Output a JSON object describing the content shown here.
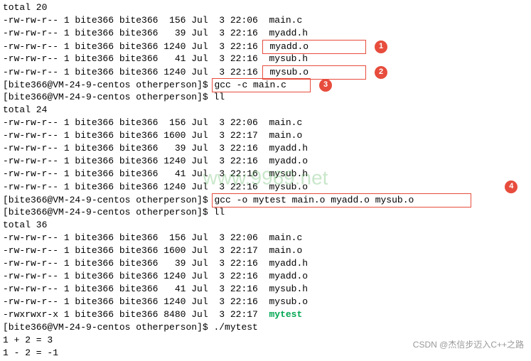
{
  "terminal": {
    "lines": [
      {
        "t": "text",
        "c": "total 20"
      },
      {
        "t": "text",
        "c": "-rw-rw-r-- 1 bite366 bite366  156 Jul  3 22:06  main.c"
      },
      {
        "t": "text",
        "c": "-rw-rw-r-- 1 bite366 bite366   39 Jul  3 22:16  myadd.h"
      },
      {
        "t": "file-box",
        "prefix": "-rw-rw-r-- 1 bite366 bite366 1240 Jul  3 22:16 ",
        "boxed": "myadd.o",
        "pad": "          ",
        "badge": "1"
      },
      {
        "t": "text",
        "c": "-rw-rw-r-- 1 bite366 bite366   41 Jul  3 22:16  mysub.h"
      },
      {
        "t": "file-box",
        "prefix": "-rw-rw-r-- 1 bite366 bite366 1240 Jul  3 22:16 ",
        "boxed": "mysub.o",
        "pad": "          ",
        "badge": "2"
      },
      {
        "t": "prompt-box",
        "prompt": "[bite366@VM-24-9-centos otherperson]$ ",
        "boxed": "gcc -c main.c",
        "pad": "    ",
        "badge": "3"
      },
      {
        "t": "prompt",
        "prompt": "[bite366@VM-24-9-centos otherperson]$ ",
        "cmd": "ll"
      },
      {
        "t": "text",
        "c": "total 24"
      },
      {
        "t": "text",
        "c": "-rw-rw-r-- 1 bite366 bite366  156 Jul  3 22:06  main.c"
      },
      {
        "t": "text",
        "c": "-rw-rw-r-- 1 bite366 bite366 1600 Jul  3 22:17  main.o"
      },
      {
        "t": "text",
        "c": "-rw-rw-r-- 1 bite366 bite366   39 Jul  3 22:16  myadd.h"
      },
      {
        "t": "text",
        "c": "-rw-rw-r-- 1 bite366 bite366 1240 Jul  3 22:16  myadd.o"
      },
      {
        "t": "text",
        "c": "-rw-rw-r-- 1 bite366 bite366   41 Jul  3 22:16  mysub.h"
      },
      {
        "t": "file-badge",
        "c": "-rw-rw-r-- 1 bite366 bite366 1240 Jul  3 22:16  mysub.o",
        "pad": "                                  ",
        "badge": "4"
      },
      {
        "t": "prompt-box",
        "prompt": "[bite366@VM-24-9-centos otherperson]$ ",
        "boxed": "gcc -o mytest main.o myadd.o mysub.o",
        "pad": "          "
      },
      {
        "t": "prompt",
        "prompt": "[bite366@VM-24-9-centos otherperson]$ ",
        "cmd": "ll"
      },
      {
        "t": "text",
        "c": "total 36"
      },
      {
        "t": "text",
        "c": "-rw-rw-r-- 1 bite366 bite366  156 Jul  3 22:06  main.c"
      },
      {
        "t": "text",
        "c": "-rw-rw-r-- 1 bite366 bite366 1600 Jul  3 22:17  main.o"
      },
      {
        "t": "text",
        "c": "-rw-rw-r-- 1 bite366 bite366   39 Jul  3 22:16  myadd.h"
      },
      {
        "t": "text",
        "c": "-rw-rw-r-- 1 bite366 bite366 1240 Jul  3 22:16  myadd.o"
      },
      {
        "t": "text",
        "c": "-rw-rw-r-- 1 bite366 bite366   41 Jul  3 22:16  mysub.h"
      },
      {
        "t": "text",
        "c": "-rw-rw-r-- 1 bite366 bite366 1240 Jul  3 22:16  mysub.o"
      },
      {
        "t": "exec-line",
        "prefix": "-rwxrwxr-x 1 bite366 bite366 8480 Jul  3 22:17  ",
        "exec": "mytest"
      },
      {
        "t": "prompt",
        "prompt": "[bite366@VM-24-9-centos otherperson]$ ",
        "cmd": "./mytest"
      },
      {
        "t": "text",
        "c": "1 + 2 = 3"
      },
      {
        "t": "text",
        "c": "1 - 2 = -1"
      }
    ]
  },
  "watermark": "www.9969.net",
  "footer": "CSDN @杰信步迈入C++之路"
}
